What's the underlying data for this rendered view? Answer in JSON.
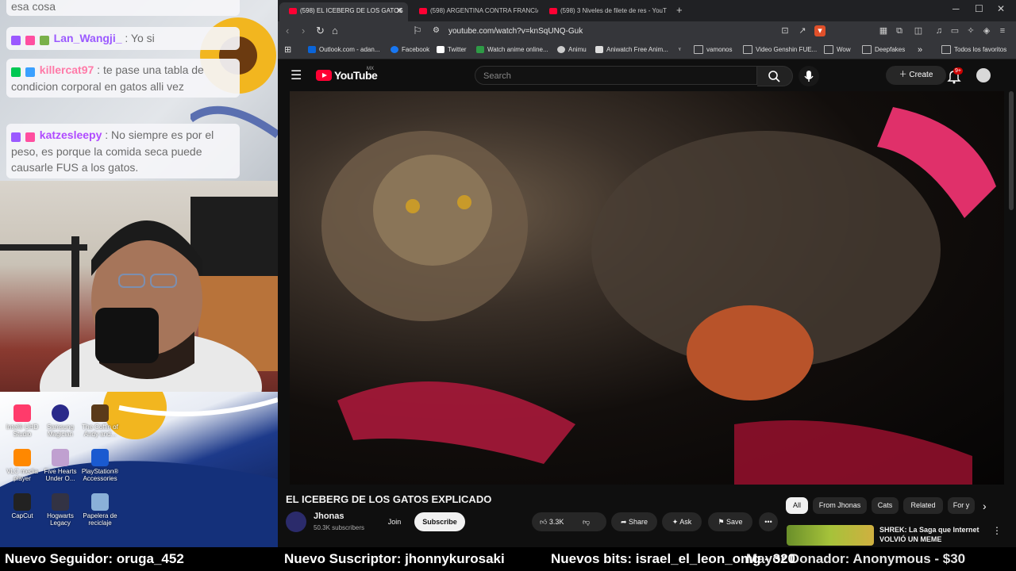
{
  "chat": {
    "messages": [
      {
        "user": "",
        "text": "esa cosa",
        "user_color": "#9b59ff"
      },
      {
        "user": "Lan_Wangji_",
        "text": ": Yo si",
        "user_color": "#9b59ff"
      },
      {
        "user": "killercat97",
        "text": ": te pase una tabla de condicion corporal en gatos alli vez",
        "user_color": "#ff7aa8"
      },
      {
        "user": "katzesleepy",
        "text": ": No siempre es por el peso, es porque la comida seca puede causarle FUS a los gatos.",
        "user_color": "#b04bff"
      }
    ]
  },
  "desktop": {
    "icons": [
      {
        "label": "Intel® UHD Studio",
        "color": "#ff3b6b"
      },
      {
        "label": "Samsung Magician",
        "color": "#2a2a8a"
      },
      {
        "label": "The Coffin of Andy and...",
        "color": "#5a3a1a"
      },
      {
        "label": "VLC media player",
        "color": "#ff8800"
      },
      {
        "label": "Five Hearts Under O...",
        "color": "#c0a0d0"
      },
      {
        "label": "PlayStation® Accessories",
        "color": "#1a5ad0"
      },
      {
        "label": "CapCut",
        "color": "#222222"
      },
      {
        "label": "Hogwarts Legacy",
        "color": "#333344"
      },
      {
        "label": "Papelera de reciclaje",
        "color": "#8ab0d8"
      }
    ]
  },
  "browser": {
    "tabs": [
      {
        "label": "(598) EL ICEBERG DE LOS GATOS",
        "active": true
      },
      {
        "label": "(598) ARGENTINA CONTRA FRANCIA",
        "active": false
      },
      {
        "label": "(598) 3 Niveles de filete de res - YouT",
        "active": false
      }
    ],
    "new_tab": "+",
    "url": "youtube.com/watch?v=knSqUNQ-Guk",
    "bookmarks": [
      {
        "label": "Outlook.com - adan...",
        "icon": "outlook-icon",
        "color": "#0a64d8"
      },
      {
        "label": "Facebook",
        "icon": "facebook-icon",
        "color": "#1877f2"
      },
      {
        "label": "Twitter",
        "icon": "x-icon",
        "color": "#ffffff"
      },
      {
        "label": "Watch anime online...",
        "icon": "anime-icon",
        "color": "#2e9b46"
      },
      {
        "label": "Animu",
        "icon": "animu-icon",
        "color": "#cccccc"
      },
      {
        "label": "Aniwatch Free Anim...",
        "icon": "aniwatch-icon",
        "color": "#dddddd"
      },
      {
        "label": "vamonos",
        "icon": "folder-icon",
        "color": ""
      },
      {
        "label": "Video Genshin FUE...",
        "icon": "folder-icon",
        "color": ""
      },
      {
        "label": "Wow",
        "icon": "folder-icon",
        "color": ""
      },
      {
        "label": "Deepfakes",
        "icon": "folder-icon",
        "color": ""
      }
    ],
    "all_bookmarks": "Todos los favoritos"
  },
  "youtube": {
    "logo": "YouTube",
    "region": "MX",
    "search_placeholder": "Search",
    "create_label": "Create",
    "notifications": "9+",
    "video_title": "EL ICEBERG DE LOS GATOS EXPLICADO",
    "channel_name": "Jhonas",
    "channel_subs": "50.3K subscribers",
    "join_label": "Join",
    "subscribe_label": "Subscribe",
    "likes": "3.3K",
    "share_label": "Share",
    "ask_label": "Ask",
    "save_label": "Save",
    "chips": [
      "All",
      "From Jhonas",
      "Cats",
      "Related",
      "For y"
    ],
    "recommended": [
      {
        "title": "SHREK: La Saga que Internet VOLVIÓ UN MEME"
      }
    ],
    "accent": "#ff0033"
  },
  "ticker": {
    "items": [
      "Nuevo Seguidor: oruga_452",
      "Nuevo Suscriptor: jhonnykurosaki",
      "Nuevos bits: israel_el_leon_omg - 320",
      "Mayor Donador: Anonymous - $30"
    ]
  }
}
